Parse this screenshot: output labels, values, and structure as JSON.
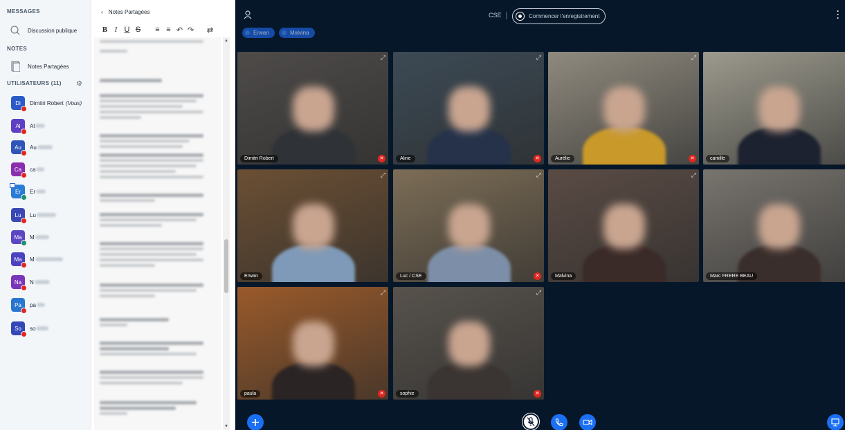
{
  "sidebar": {
    "messages_title": "MESSAGES",
    "public_chat": "Discussion publique",
    "notes_title": "NOTES",
    "shared_notes": "Notes Partagées",
    "users_title": "UTILISATEURS (11)",
    "users": [
      {
        "initials": "Di",
        "name": "Dimitri Robert",
        "you_suffix": "(Vous)",
        "color": "#2a5ac8",
        "status": "muted"
      },
      {
        "initials": "Al",
        "name": "Al",
        "color": "#5b3fc4",
        "status": "muted"
      },
      {
        "initials": "Au",
        "name": "Au",
        "color": "#2f55b8",
        "status": "muted"
      },
      {
        "initials": "Ca",
        "name": "ca",
        "color": "#8a2eb0",
        "status": "muted"
      },
      {
        "initials": "Er",
        "name": "Er",
        "color": "#2a7bd6",
        "status": "listen"
      },
      {
        "initials": "Lu",
        "name": "Lu",
        "color": "#3a47b4",
        "status": "muted"
      },
      {
        "initials": "Ma",
        "name": "M",
        "color": "#5d46c4",
        "status": "listen"
      },
      {
        "initials": "Ma",
        "name": "M",
        "color": "#4a42c0",
        "status": "muted"
      },
      {
        "initials": "Na",
        "name": "N",
        "color": "#7a36b8",
        "status": "muted"
      },
      {
        "initials": "Pa",
        "name": "pa",
        "color": "#2876cf",
        "status": "muted"
      },
      {
        "initials": "So",
        "name": "so",
        "color": "#3447b8",
        "status": "muted"
      }
    ]
  },
  "notes": {
    "back_label": "Notes Partagées",
    "toolbar": [
      "B",
      "I",
      "U",
      "S",
      "≡",
      "≡",
      "↶",
      "↷",
      "⇄"
    ]
  },
  "meeting": {
    "presenter_label": "CSE",
    "record_label": "Commencer l'enregistrement",
    "talkers": [
      "Erwan",
      "Malvina"
    ],
    "tiles": [
      {
        "label": "Dimitri Robert",
        "muted": true,
        "bg": "#4e4b49",
        "body": "#2f3236"
      },
      {
        "label": "Aline",
        "muted": true,
        "bg": "#3c4a55",
        "body": "#25324a"
      },
      {
        "label": "Aurélie",
        "muted": true,
        "bg": "#8f8a7e",
        "body": "#c99a2a"
      },
      {
        "label": "camille",
        "muted": false,
        "bg": "#9c9a8d",
        "body": "#1d2230"
      },
      {
        "label": "Erwan",
        "muted": false,
        "bg": "#6b4f34",
        "body": "#7e9ab8"
      },
      {
        "label": "Luc / CSE",
        "muted": true,
        "bg": "#7c6d56",
        "body": "#7d8fa8"
      },
      {
        "label": "Malvina",
        "muted": false,
        "bg": "#5a4b44",
        "body": "#3a2a28"
      },
      {
        "label": "Marc FRERE BEAU",
        "muted": false,
        "bg": "#78746e",
        "body": "#3a2e2c"
      },
      {
        "label": "paula",
        "muted": true,
        "bg": "#9a5a2a",
        "body": "#2a2424"
      },
      {
        "label": "sophie",
        "muted": true,
        "bg": "#57524c",
        "body": "#3a3432"
      }
    ]
  }
}
